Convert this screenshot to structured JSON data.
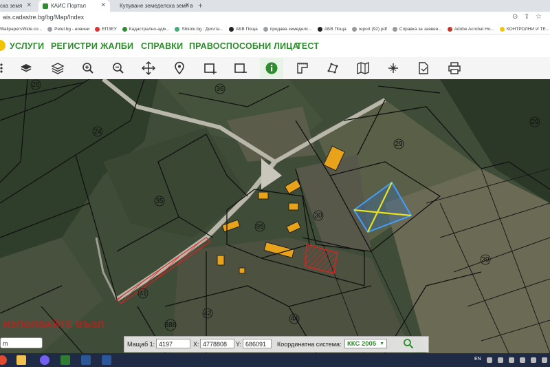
{
  "browser": {
    "tabs": [
      {
        "label": "ска земя",
        "active": false
      },
      {
        "label": "КАИС Портал",
        "active": true
      },
      {
        "label": "Купуване земеделска земя в ...",
        "active": false
      }
    ],
    "url": "ais.cadastre.bg/bg/Map/Index",
    "bookmarks": [
      "WallpapersWide.co...",
      "Petel.bg - новини",
      "ЕПЗЕУ",
      "Кадастрално-адм...",
      "Shkolo.bg : Дигита...",
      "АБВ Поща",
      "продава земеделс...",
      "АБВ Поща",
      "report (92).pdf",
      "Справка за заявен...",
      "Adobe Acrobat Ho...",
      "КОНТРОЛНИ И ТЕ..."
    ]
  },
  "nav": {
    "items": [
      "УСЛУГИ",
      "РЕГИСТРИ",
      "ЖАЛБИ",
      "СПРАВКИ",
      "ПРАВОСПОСОБНИ ЛИЦА",
      "ТЕСТ"
    ]
  },
  "toolbar": {
    "tools": [
      "layers-icon",
      "layers-outline-icon",
      "zoom-in-icon",
      "zoom-out-icon",
      "pan-icon",
      "location-pin-icon",
      "select-rect-icon",
      "deselect-rect-icon",
      "info-icon",
      "measure-distance-icon",
      "measure-area-icon",
      "map-icon",
      "coordinates-icon",
      "document-icon",
      "print-icon"
    ],
    "active": "info-icon"
  },
  "map": {
    "plot_numbers": [
      "26",
      "36",
      "24",
      "35",
      "95",
      "30",
      "39",
      "41",
      "42",
      "44",
      "888",
      "29"
    ],
    "overlay_text": "ИЗПОЛВАЙТЕ ВЪЗЛ"
  },
  "scale": {
    "scale_label": "Мащаб 1:",
    "scale_value": "4197",
    "x_label": "X:",
    "x_value": "4778808",
    "y_label": "Y:",
    "y_value": "686091",
    "system_label": "Координатна система:",
    "system_value": "ККС 2005"
  },
  "search_small": {
    "value": "m"
  },
  "taskbar": {
    "lang": "EN"
  }
}
